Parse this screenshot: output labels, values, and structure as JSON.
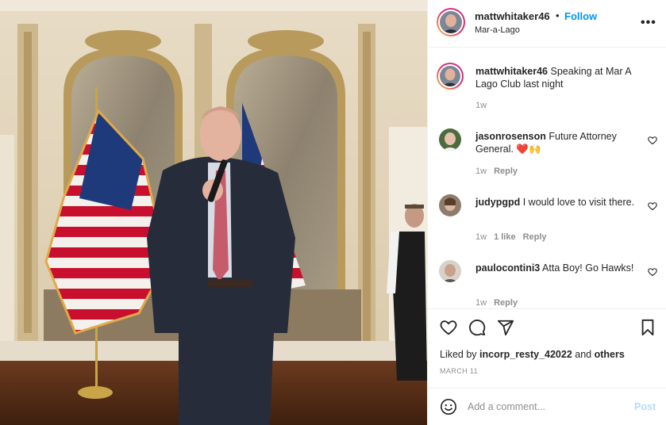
{
  "post": {
    "username": "mattwhitaker46",
    "follow_label": "Follow",
    "location": "Mar-a-Lago",
    "more_label": "•••"
  },
  "caption": {
    "username": "mattwhitaker46",
    "text": "Speaking at Mar A Lago Club last night",
    "time": "1w"
  },
  "comments": [
    {
      "username": "jasonrosenson",
      "text": "Future Attorney General. ❤️🙌",
      "time": "1w",
      "likes": "",
      "reply_label": "Reply"
    },
    {
      "username": "judypgpd",
      "text": "I would love to visit there.",
      "time": "1w",
      "likes": "1 like",
      "reply_label": "Reply"
    },
    {
      "username": "paulocontini3",
      "text": "Atta Boy! Go Hawks!",
      "time": "1w",
      "likes": "",
      "reply_label": "Reply"
    }
  ],
  "actions": {
    "liked_prefix": "Liked by",
    "liked_user": "incorp_resty_42022",
    "liked_and": "and",
    "liked_others": "others",
    "date": "March 11"
  },
  "add_comment": {
    "placeholder": "Add a comment...",
    "post_label": "Post"
  },
  "colors": {
    "link_blue": "#0095f6",
    "post_disabled": "#b3dbff",
    "secondary_text": "#8e8e8e"
  },
  "icons": [
    "more-icon",
    "heart-icon",
    "comment-icon",
    "share-icon",
    "bookmark-icon",
    "emoji-icon"
  ]
}
